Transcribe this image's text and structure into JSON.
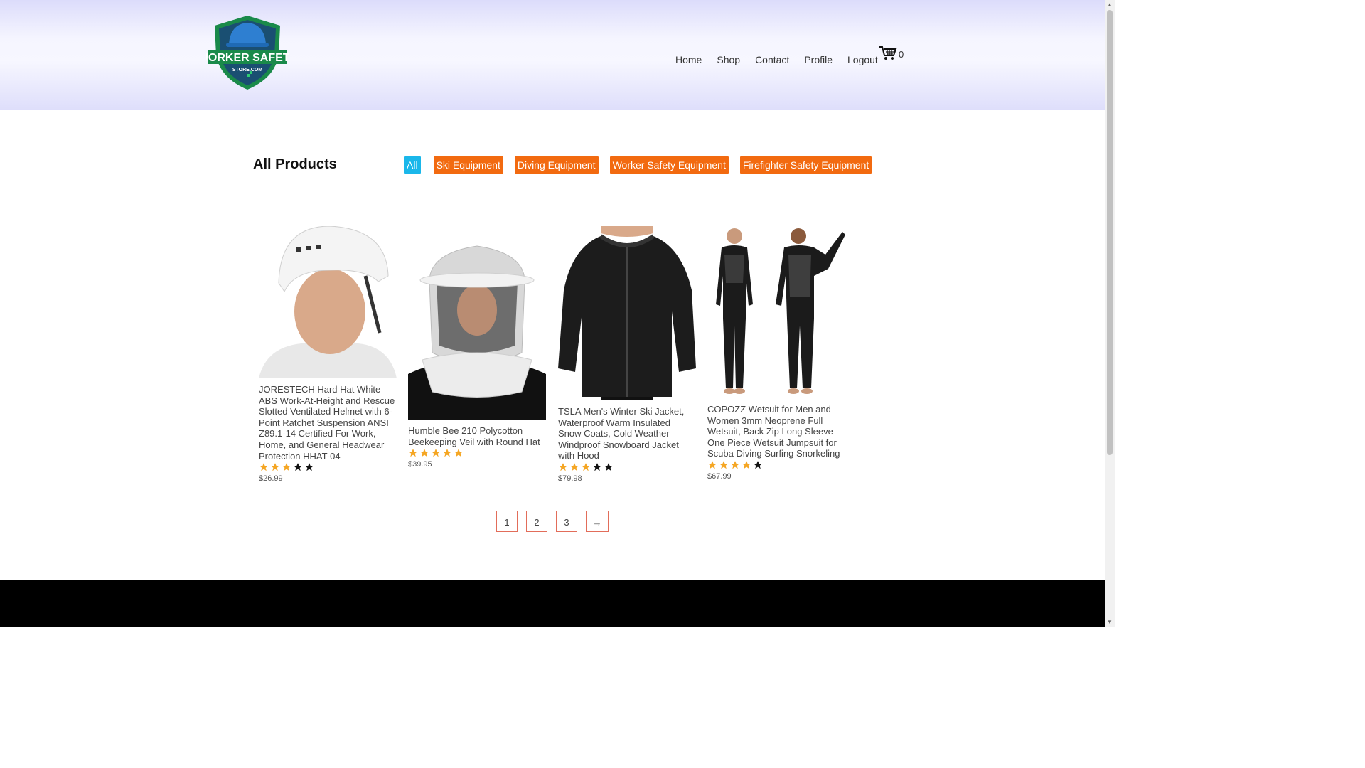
{
  "brand": {
    "line1": "WORKER SAFETY",
    "line2": "STORE.COM"
  },
  "nav": [
    {
      "label": "Home"
    },
    {
      "label": "Shop"
    },
    {
      "label": "Contact"
    },
    {
      "label": "Profile"
    },
    {
      "label": "Logout"
    }
  ],
  "cart": {
    "count": "0",
    "icon": "cart-icon"
  },
  "page_title": "All Products",
  "filters": [
    {
      "label": "All",
      "active": true,
      "color": "#1ab7ea"
    },
    {
      "label": "Ski Equipment",
      "active": false,
      "color": "#f26a10"
    },
    {
      "label": "Diving Equipment",
      "active": false,
      "color": "#f26a10"
    },
    {
      "label": "Worker Safety Equipment",
      "active": false,
      "color": "#f26a10"
    },
    {
      "label": "Firefighter Safety Equipment",
      "active": false,
      "color": "#f26a10"
    }
  ],
  "products": [
    {
      "name": "JORESTECH Hard Hat White ABS Work-At-Height and Rescue Slotted Ventilated Helmet with 6-Point Ratchet Suspension ANSI Z89.1-14 Certified For Work, Home, and General Headwear Protection HHAT-04",
      "rating": 3,
      "price": "$26.99",
      "image": "hard-hat-helmet"
    },
    {
      "name": "Humble Bee 210 Polycotton Beekeeping Veil with Round Hat",
      "rating": 5,
      "price": "$39.95",
      "image": "beekeeping-veil"
    },
    {
      "name": "TSLA Men's Winter Ski Jacket, Waterproof Warm Insulated Snow Coats, Cold Weather Windproof Snowboard Jacket with Hood",
      "rating": 3,
      "price": "$79.98",
      "image": "ski-jacket"
    },
    {
      "name": "COPOZZ Wetsuit for Men and Women 3mm Neoprene Full Wetsuit, Back Zip Long Sleeve One Piece Wetsuit Jumpsuit for Scuba Diving Surfing Snorkeling",
      "rating": 4,
      "price": "$67.99",
      "image": "wetsuit"
    }
  ],
  "pagination": [
    "1",
    "2",
    "3",
    "→"
  ],
  "colors": {
    "accent_blue": "#1ab7ea",
    "accent_orange": "#f26a10",
    "star_filled": "#f5a623",
    "star_empty": "#111111",
    "page_border": "#e26d5a"
  }
}
